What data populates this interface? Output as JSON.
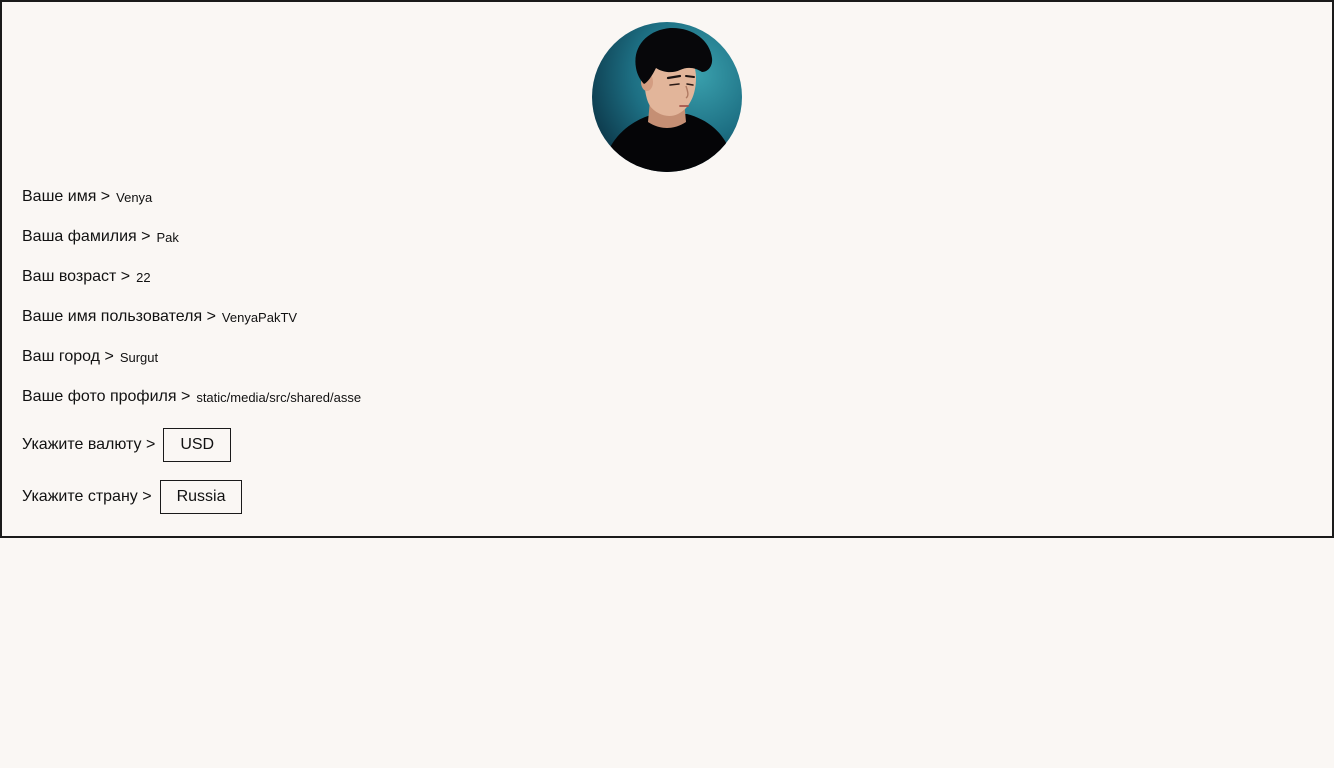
{
  "profile": {
    "avatar_icon": "profile-photo",
    "fields": [
      {
        "label": "Ваше имя >",
        "value": "Venya"
      },
      {
        "label": "Ваша фамилия >",
        "value": "Pak"
      },
      {
        "label": "Ваш возраст >",
        "value": "22"
      },
      {
        "label": "Ваше имя пользователя >",
        "value": "VenyaPakTV"
      },
      {
        "label": "Ваш город >",
        "value": "Surgut"
      },
      {
        "label": "Ваше фото профиля >",
        "value": "static/media/src/shared/asse"
      }
    ],
    "currency": {
      "label": "Укажите валюту >",
      "value": "USD"
    },
    "country": {
      "label": "Укажите страну >",
      "value": "Russia"
    }
  },
  "colors": {
    "background": "#faf7f4",
    "border": "#1a1a1a",
    "avatar_bg": "#1d6f83"
  }
}
